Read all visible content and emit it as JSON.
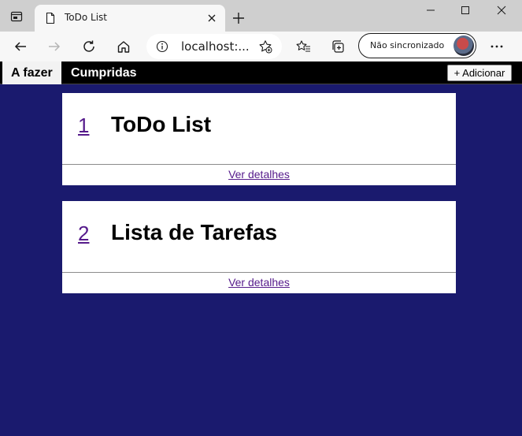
{
  "browser": {
    "tab_title": "ToDo List",
    "address_url": "localhost:...",
    "profile_label": "Não sincronizado"
  },
  "nav": {
    "tabs": [
      {
        "label": "A fazer",
        "active": true
      },
      {
        "label": "Cumpridas",
        "active": false
      }
    ],
    "add_button_label": "+ Adicionar"
  },
  "lists": [
    {
      "number": "1",
      "title": "ToDo List",
      "details_link": "Ver detalhes"
    },
    {
      "number": "2",
      "title": "Lista de Tarefas",
      "details_link": "Ver detalhes"
    }
  ],
  "colors": {
    "page_background": "#1a1a6e",
    "nav_background": "#000000",
    "link_visited": "#551a8b"
  }
}
